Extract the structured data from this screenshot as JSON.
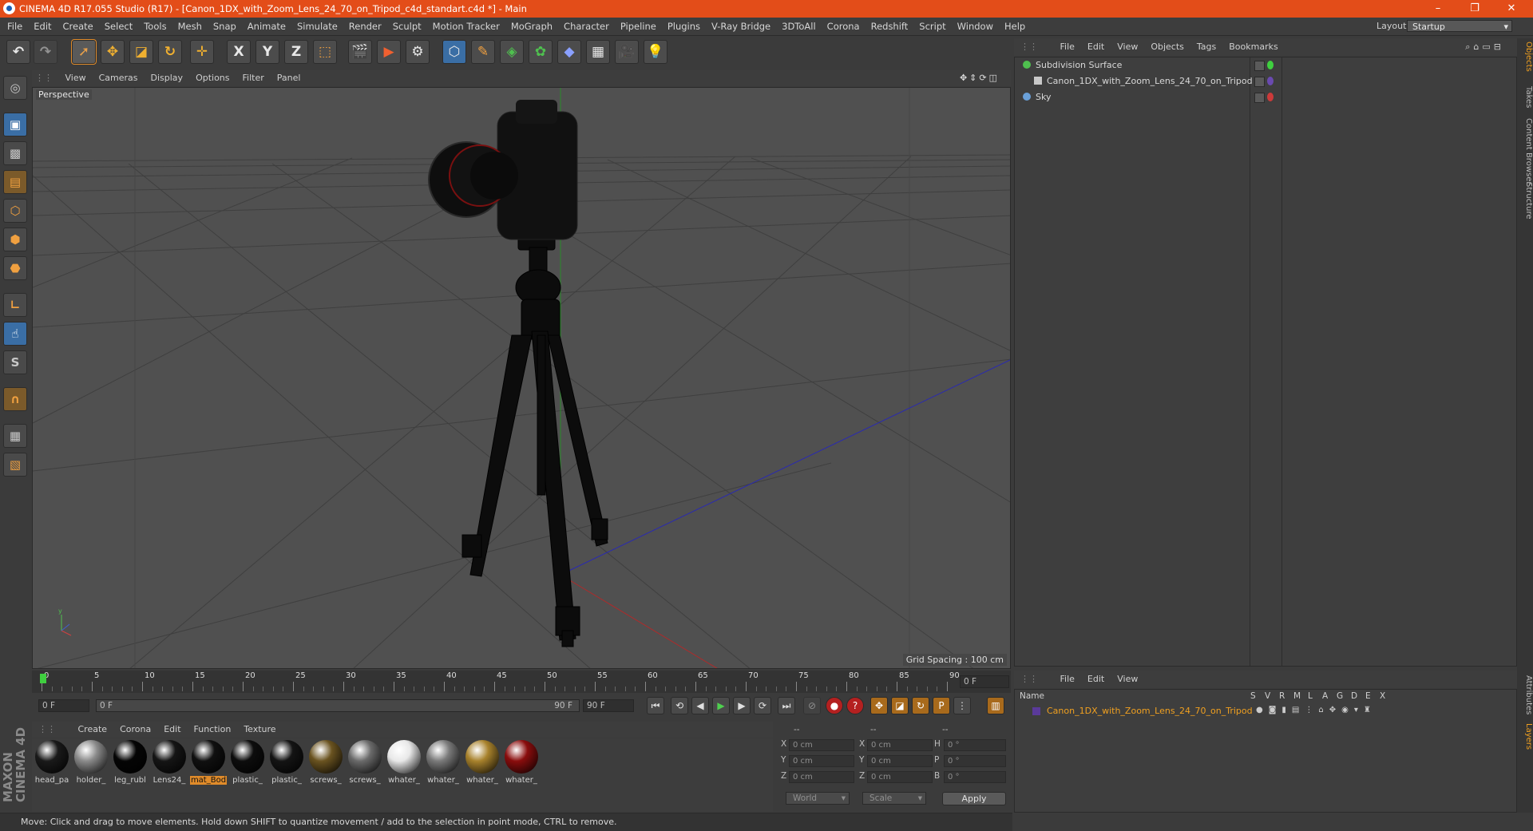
{
  "window": {
    "title": "CINEMA 4D R17.055 Studio (R17) - [Canon_1DX_with_Zoom_Lens_24_70_on_Tripod_c4d_standart.c4d *] - Main",
    "minimize": "–",
    "maximize": "❐",
    "close": "✕"
  },
  "menu": [
    "File",
    "Edit",
    "Create",
    "Select",
    "Tools",
    "Mesh",
    "Snap",
    "Animate",
    "Simulate",
    "Render",
    "Sculpt",
    "Motion Tracker",
    "MoGraph",
    "Character",
    "Pipeline",
    "Plugins",
    "V-Ray Bridge",
    "3DToAll",
    "Corona",
    "Redshift",
    "Script",
    "Window",
    "Help"
  ],
  "layout": {
    "label": "Layout:",
    "value": "Startup"
  },
  "toolbar": {
    "x_label": "X",
    "y_label": "Y",
    "z_label": "Z"
  },
  "viewport": {
    "menu": [
      "View",
      "Cameras",
      "Display",
      "Options",
      "Filter",
      "Panel"
    ],
    "label": "Perspective",
    "grid_spacing": "Grid Spacing : 100 cm"
  },
  "timeline": {
    "ticks": [
      "0",
      "5",
      "10",
      "15",
      "20",
      "25",
      "30",
      "35",
      "40",
      "45",
      "50",
      "55",
      "60",
      "65",
      "70",
      "75",
      "80",
      "85",
      "90"
    ],
    "current_frame_field": "0 F",
    "start_field": "0 F",
    "range_start": "0 F",
    "range_end": "90 F",
    "end_field": "90 F"
  },
  "materials": {
    "menu": [
      "Create",
      "Corona",
      "Edit",
      "Function",
      "Texture"
    ],
    "items": [
      {
        "name": "head_pa",
        "color": "#1a1a1a"
      },
      {
        "name": "holder_",
        "color": "#8a8a8a"
      },
      {
        "name": "leg_rubl",
        "color": "#050505"
      },
      {
        "name": "Lens24_",
        "color": "#151515"
      },
      {
        "name": "mat_Bod",
        "color": "#101010"
      },
      {
        "name": "plastic_",
        "color": "#0d0d0d"
      },
      {
        "name": "plastic_",
        "color": "#141414"
      },
      {
        "name": "screws_",
        "color": "#6a5320"
      },
      {
        "name": "screws_",
        "color": "#6a6a6a"
      },
      {
        "name": "whater_",
        "color": "#e8e8e8"
      },
      {
        "name": "whater_",
        "color": "#7a7a7a"
      },
      {
        "name": "whater_",
        "color": "#a8822c"
      },
      {
        "name": "whater_",
        "color": "#8a0d0d"
      }
    ],
    "selected_index": 4
  },
  "coordinates": {
    "headers": [
      "--",
      "--",
      "--"
    ],
    "rows": [
      {
        "a": "X",
        "av": "0 cm",
        "b": "X",
        "bv": "0 cm",
        "c": "H",
        "cv": "0 °"
      },
      {
        "a": "Y",
        "av": "0 cm",
        "b": "Y",
        "bv": "0 cm",
        "c": "P",
        "cv": "0 °"
      },
      {
        "a": "Z",
        "av": "0 cm",
        "b": "Z",
        "bv": "0 cm",
        "c": "B",
        "cv": "0 °"
      }
    ],
    "mode": "World",
    "scale": "Scale",
    "apply": "Apply"
  },
  "status": "Move: Click and drag to move elements. Hold down SHIFT to quantize movement / add to the selection in point mode, CTRL to remove.",
  "objects_panel": {
    "menu": [
      "File",
      "Edit",
      "View",
      "Objects",
      "Tags",
      "Bookmarks"
    ],
    "items": [
      {
        "name": "Subdivision Surface",
        "color": "#4fc04f"
      },
      {
        "name": "Canon_1DX_with_Zoom_Lens_24_70_on_Tripod",
        "color": "#c8c8c8"
      },
      {
        "name": "Sky",
        "color": "#6aa0d8"
      }
    ]
  },
  "right_tabs": [
    "Objects",
    "Takes",
    "Content Browser",
    "Structure"
  ],
  "layers_tabs": [
    "Attributes",
    "Layers"
  ],
  "layers_panel": {
    "menu": [
      "File",
      "Edit",
      "View"
    ],
    "columns": [
      "Name",
      "S",
      "V",
      "R",
      "M",
      "L",
      "A",
      "G",
      "D",
      "E",
      "X"
    ],
    "row": "Canon_1DX_with_Zoom_Lens_24_70_on_Tripod"
  },
  "maxon_logo": "MAXON CINEMA 4D"
}
